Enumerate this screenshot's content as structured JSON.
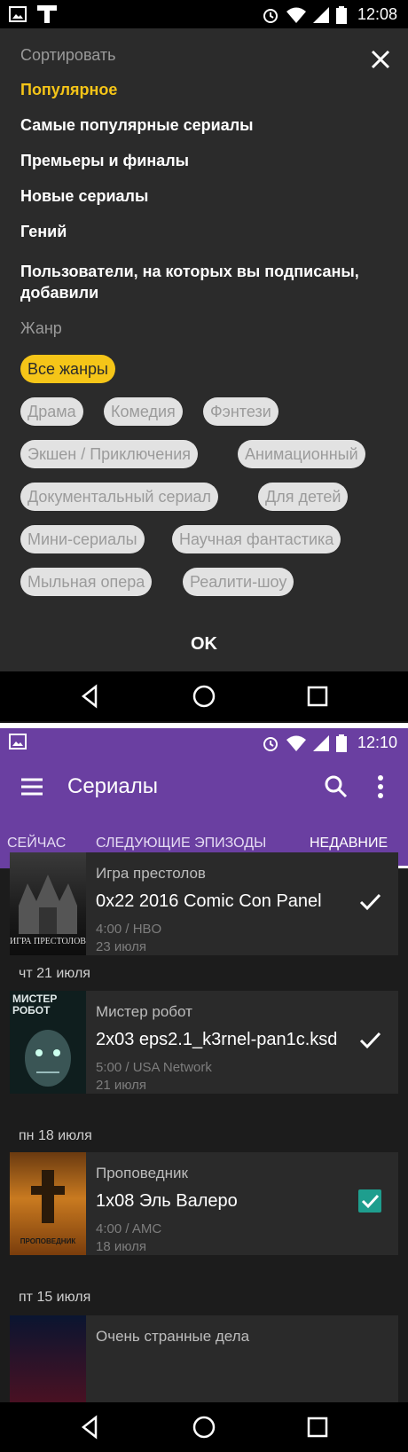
{
  "screen1": {
    "status_bar": {
      "time": "12:08"
    },
    "sort": {
      "heading": "Сортировать",
      "options": [
        {
          "label": "Популярное",
          "selected": true
        },
        {
          "label": "Самые популярные сериалы"
        },
        {
          "label": "Премьеры и финалы"
        },
        {
          "label": "Новые сериалы"
        },
        {
          "label": "Гений"
        },
        {
          "label": "Пользователи, на которых вы подписаны, добавили"
        }
      ]
    },
    "genre": {
      "heading": "Жанр",
      "chips": [
        {
          "label": "Все жанры",
          "selected": true
        },
        {
          "label": "Драма"
        },
        {
          "label": "Комедия"
        },
        {
          "label": "Фэнтези"
        },
        {
          "label": "Экшен / Приключения"
        },
        {
          "label": "Анимационный"
        },
        {
          "label": "Документальный сериал"
        },
        {
          "label": "Для детей"
        },
        {
          "label": "Мини-сериалы"
        },
        {
          "label": "Научная фантастика"
        },
        {
          "label": "Мыльная опера"
        },
        {
          "label": "Реалити-шоу"
        }
      ]
    },
    "ok_label": "OK",
    "accent": "#f5c518"
  },
  "screen2": {
    "status_bar": {
      "time": "12:10"
    },
    "title": "Сериалы",
    "tabs": [
      {
        "label": "СЕЙЧАС"
      },
      {
        "label": "СЛЕДУЮЩИЕ ЭПИЗОДЫ"
      },
      {
        "label": "НЕДАВНИЕ",
        "active": true
      }
    ],
    "accent": "#6a3fa1",
    "episodes": [
      {
        "show": "Игра престолов",
        "episode": "0x22 2016 Comic Con Panel",
        "meta": "4:00 / HBO",
        "date": "23 июля",
        "poster_text": "ИГРА ПРЕСТОЛОВ",
        "watched": true
      },
      {
        "show": "Мистер робот",
        "episode": "2x03 eps2.1_k3rnel-pan1c.ksd",
        "meta": "5:00 / USA Network",
        "date": "21 июля",
        "poster_text": "МИСТЕР РОБОТ",
        "watched": true
      },
      {
        "show": "Проповедник",
        "episode": "1x08 Эль Валеро",
        "meta": "4:00 / AMC",
        "date": "18 июля",
        "poster_text": "ПРОПОВЕДНИК",
        "watched": true,
        "checkbox": true
      },
      {
        "show": "Очень странные дела"
      }
    ],
    "date_headers": [
      "чт 21 июля",
      "пн 18 июля",
      "пт 15 июля"
    ]
  }
}
